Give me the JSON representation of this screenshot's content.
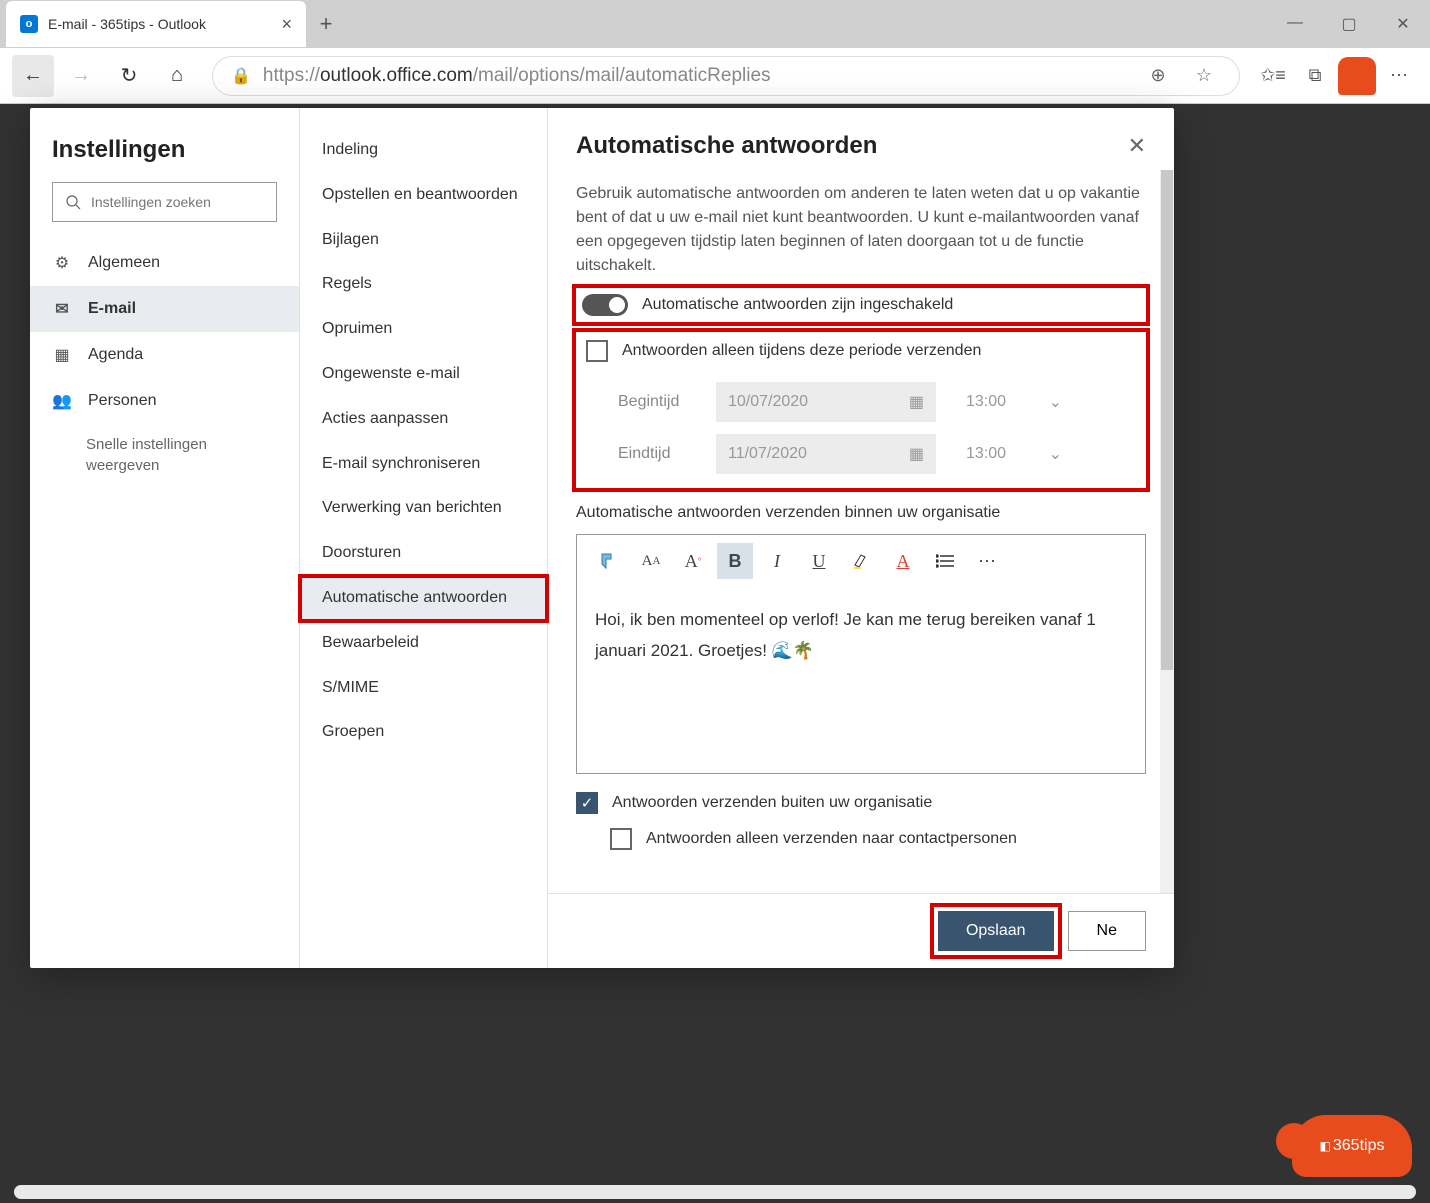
{
  "browser": {
    "tab_title": "E-mail - 365tips - Outlook",
    "url_prefix": "https://",
    "url_domain": "outlook.office.com",
    "url_path": "/mail/options/mail/automaticReplies"
  },
  "settings_title": "Instellingen",
  "search_placeholder": "Instellingen zoeken",
  "nav": {
    "general": "Algemeen",
    "email": "E-mail",
    "agenda": "Agenda",
    "people": "Personen",
    "quick": "Snelle instellingen weergeven"
  },
  "sub": {
    "indeling": "Indeling",
    "opstellen": "Opstellen en beantwoorden",
    "bijlagen": "Bijlagen",
    "regels": "Regels",
    "opruimen": "Opruimen",
    "ongewenste": "Ongewenste e-mail",
    "acties": "Acties aanpassen",
    "sync": "E-mail synchroniseren",
    "verwerking": "Verwerking van berichten",
    "doorsturen": "Doorsturen",
    "autoanswer": "Automatische antwoorden",
    "bewaar": "Bewaarbeleid",
    "smime": "S/MIME",
    "groepen": "Groepen"
  },
  "panel": {
    "title": "Automatische antwoorden",
    "desc": "Gebruik automatische antwoorden om anderen te laten weten dat u op vakantie bent of dat u uw e-mail niet kunt beantwoorden. U kunt e-mailantwoorden vanaf een opgegeven tijdstip laten beginnen of laten doorgaan tot u de functie uitschakelt.",
    "toggle_label": "Automatische antwoorden zijn ingeschakeld",
    "period_check": "Antwoorden alleen tijdens deze periode verzenden",
    "begin_label": "Begintijd",
    "end_label": "Eindtijd",
    "begin_date": "10/07/2020",
    "end_date": "11/07/2020",
    "begin_time": "13:00",
    "end_time": "13:00",
    "inside_label": "Automatische antwoorden verzenden binnen uw organisatie",
    "body_text": "Hoi, ik ben momenteel op verlof! Je kan me terug bereiken vanaf 1 januari 2021. Groetjes! 🌊🌴",
    "outside_check": "Antwoorden verzenden buiten uw organisatie",
    "outside_contacts": "Antwoorden alleen verzenden naar contactpersonen",
    "save": "Opslaan",
    "discard_prefix": "Ne"
  },
  "badge": "365tips"
}
